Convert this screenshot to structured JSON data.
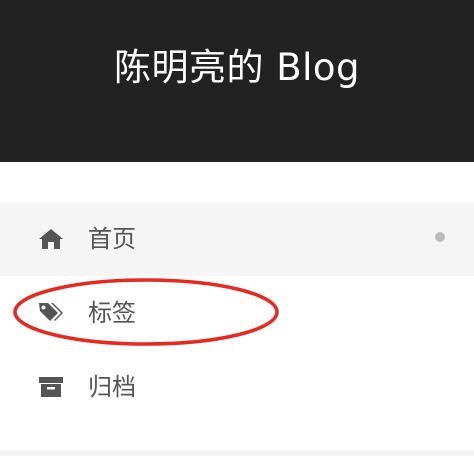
{
  "header": {
    "site_title": "陈明亮的 Blog"
  },
  "menu": {
    "items": [
      {
        "label": "首页",
        "icon": "home-icon",
        "active": true
      },
      {
        "label": "标签",
        "icon": "tags-icon",
        "active": false
      },
      {
        "label": "归档",
        "icon": "archive-icon",
        "active": false
      }
    ]
  },
  "colors": {
    "header_bg": "#222222",
    "header_text": "#ffffff",
    "menu_text": "#555555",
    "active_bg": "#f5f5f5",
    "annotation": "#e8281f"
  }
}
